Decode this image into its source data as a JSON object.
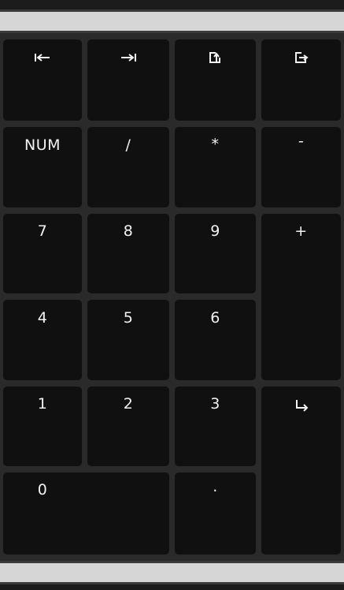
{
  "keypad": {
    "keys": [
      {
        "name": "home-key",
        "label": "",
        "icon": "skip-to-start-icon"
      },
      {
        "name": "end-key",
        "label": "",
        "icon": "skip-to-end-icon"
      },
      {
        "name": "page-up-key",
        "label": "",
        "icon": "page-up-icon"
      },
      {
        "name": "page-down-key",
        "label": "",
        "icon": "page-down-icon"
      },
      {
        "name": "num-lock-key",
        "label": "NUM"
      },
      {
        "name": "divide-key",
        "label": "/"
      },
      {
        "name": "multiply-key",
        "label": "*"
      },
      {
        "name": "minus-key",
        "label": "-"
      },
      {
        "name": "digit-7-key",
        "label": "7"
      },
      {
        "name": "digit-8-key",
        "label": "8"
      },
      {
        "name": "digit-9-key",
        "label": "9"
      },
      {
        "name": "plus-key",
        "label": "+"
      },
      {
        "name": "digit-4-key",
        "label": "4"
      },
      {
        "name": "digit-5-key",
        "label": "5"
      },
      {
        "name": "digit-6-key",
        "label": "6"
      },
      {
        "name": "digit-1-key",
        "label": "1"
      },
      {
        "name": "digit-2-key",
        "label": "2"
      },
      {
        "name": "digit-3-key",
        "label": "3"
      },
      {
        "name": "enter-key",
        "label": "",
        "icon": "enter-arrow-icon"
      },
      {
        "name": "digit-0-key",
        "label": "0"
      },
      {
        "name": "decimal-key",
        "label": "."
      }
    ]
  },
  "colors": {
    "key_background": "#101010",
    "grid_background": "#2a2a2a",
    "bar": "#d6d6d6",
    "label": "#f2f2f2"
  }
}
